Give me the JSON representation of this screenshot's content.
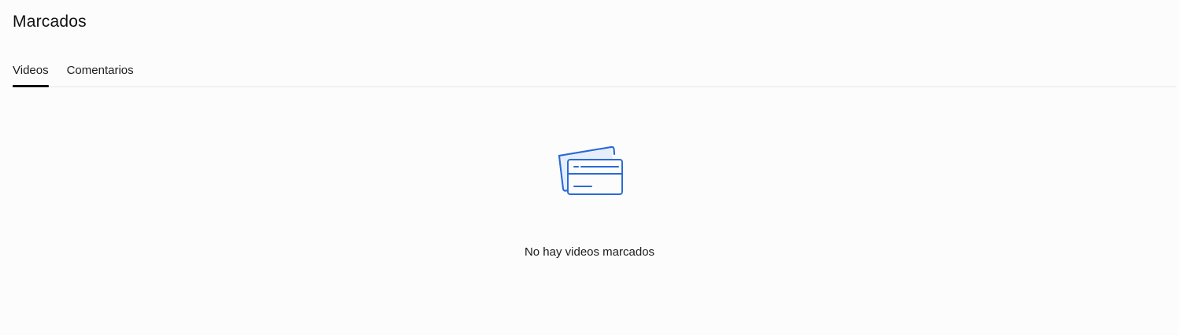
{
  "header": {
    "title": "Marcados"
  },
  "tabs": [
    {
      "label": "Videos",
      "active": true
    },
    {
      "label": "Comentarios",
      "active": false
    }
  ],
  "empty_state": {
    "icon": "bookmark-cards-icon",
    "message": "No hay videos marcados"
  },
  "colors": {
    "accent": "#2a6bd6",
    "icon_fill": "#e6eefb"
  }
}
